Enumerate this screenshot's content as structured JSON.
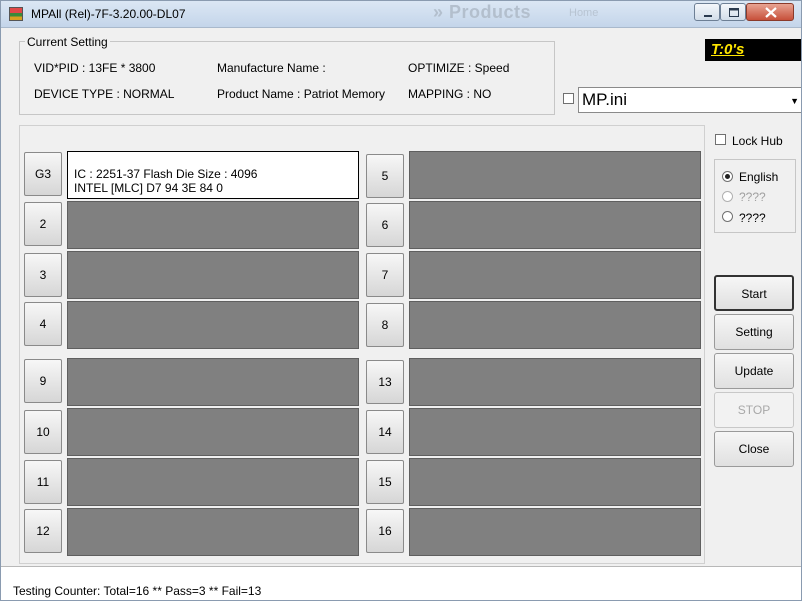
{
  "window": {
    "title": "MPAll (Rel)-7F-3.20.00-DL07",
    "background_text_1": "» Products",
    "background_text_2": "Home"
  },
  "current_setting": {
    "legend": "Current Setting",
    "vid_pid": "VID*PID : 13FE * 3800",
    "manufacture_name": "Manufacture Name :",
    "optimize": "OPTIMIZE : Speed",
    "device_type": "DEVICE TYPE : NORMAL",
    "product_name": "Product Name : Patriot Memory",
    "mapping": "MAPPING : NO"
  },
  "timer": {
    "text": "T:0's",
    "color": "#ffe600"
  },
  "ini": {
    "checked": false,
    "value": "MP.ini"
  },
  "lock_hub": {
    "label": "Lock Hub",
    "checked": false
  },
  "language": {
    "options": [
      {
        "label": "English",
        "selected": true,
        "enabled": true
      },
      {
        "label": "????",
        "selected": false,
        "enabled": false
      },
      {
        "label": "????",
        "selected": false,
        "enabled": true
      }
    ]
  },
  "ports": {
    "left": [
      {
        "label": "G3",
        "active": true,
        "line1": "IC : 2251-37  Flash Die Size : 4096",
        "line2": "INTEL [MLC] D7 94 3E 84 0"
      },
      {
        "label": "2"
      },
      {
        "label": "3"
      },
      {
        "label": "4"
      },
      {
        "label": "9"
      },
      {
        "label": "10"
      },
      {
        "label": "11"
      },
      {
        "label": "12"
      }
    ],
    "right": [
      {
        "label": "5"
      },
      {
        "label": "6"
      },
      {
        "label": "7"
      },
      {
        "label": "8"
      },
      {
        "label": "13"
      },
      {
        "label": "14"
      },
      {
        "label": "15"
      },
      {
        "label": "16"
      }
    ]
  },
  "actions": {
    "start": "Start",
    "setting": "Setting",
    "update": "Update",
    "stop": "STOP",
    "close": "Close"
  },
  "status": {
    "text": "Testing Counter: Total=16 ** Pass=3 ** Fail=13"
  },
  "colors": {
    "idle_port": "#808080",
    "active_port": "#ffffff"
  }
}
